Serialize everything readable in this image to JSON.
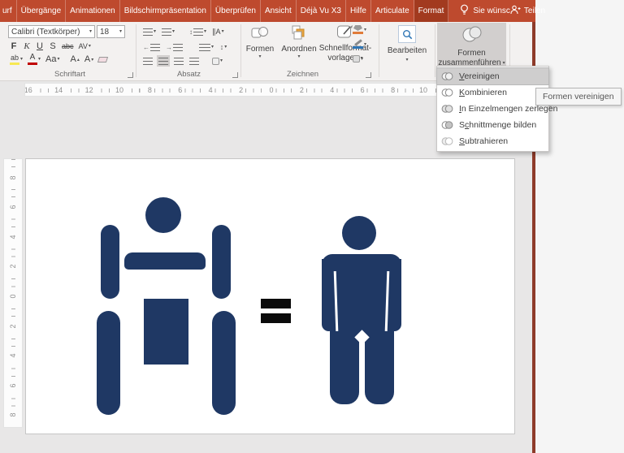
{
  "colors": {
    "tab_bar": "#BE4A2E",
    "tab_active": "#A23A1F",
    "window_border": "#8E3B2A",
    "ribbon_bg": "#F3F1F0",
    "pressed_gray": "#D2CFCE",
    "workspace_gray": "#E8E7E7",
    "shape_navy": "#1F3864",
    "equals_black": "#0B0B0B",
    "menu_highlight": "#CFCECE",
    "accent_orange": "#E8A33D",
    "accent_blue": "#2E75B5"
  },
  "tabbar": {
    "tabs": [
      {
        "label": "urf",
        "active": false
      },
      {
        "label": "Übergänge",
        "active": false
      },
      {
        "label": "Animationen",
        "active": false
      },
      {
        "label": "Bildschirmpräsentation",
        "active": false
      },
      {
        "label": "Überprüfen",
        "active": false
      },
      {
        "label": "Ansicht",
        "active": false
      },
      {
        "label": "Déjà Vu X3",
        "active": false
      },
      {
        "label": "Hilfe",
        "active": false
      },
      {
        "label": "Articulate",
        "active": false
      },
      {
        "label": "Format",
        "active": true
      }
    ],
    "tell_me": "Sie wünsc",
    "share": "Teilen"
  },
  "ribbon": {
    "font": {
      "title": "Schriftart",
      "name": "Calibri (Textkörper)",
      "size": "18",
      "bold": "F",
      "italic": "K",
      "underline": "U",
      "shadow": "S",
      "strike": "abc",
      "spacing": "AV",
      "highlight": "ab",
      "color": "A",
      "case": "Aa",
      "grow": "A",
      "shrink": "A"
    },
    "paragraph": {
      "title": "Absatz",
      "direction": "∥A",
      "valign": "↕",
      "outdent": "←",
      "indent": "→"
    },
    "drawing": {
      "title": "Zeichnen",
      "shapes": "Formen",
      "arrange": "Anordnen",
      "quick1": "Schnellformat-",
      "quick2": "vorlagen"
    },
    "editing": {
      "title": "Bearbeiten"
    },
    "merge": {
      "line1": "Formen",
      "line2": "zusammenführen"
    }
  },
  "merge_menu": {
    "items": [
      {
        "label": "Vereinigen",
        "underline_index": 0,
        "type": "union",
        "highlighted": true
      },
      {
        "label": "Kombinieren",
        "underline_index": 0,
        "type": "combine",
        "highlighted": false
      },
      {
        "label": "In Einzelmengen zerlegen",
        "underline_index": 0,
        "type": "fragment",
        "highlighted": false
      },
      {
        "label": "Schnittmenge bilden",
        "underline_index": 1,
        "type": "intersect",
        "highlighted": false
      },
      {
        "label": "Subtrahieren",
        "underline_index": 0,
        "type": "subtract",
        "highlighted": false
      }
    ]
  },
  "tooltip": "Formen vereinigen",
  "rulers": {
    "horizontal": [
      16,
      14,
      12,
      10,
      8,
      6,
      4,
      2,
      0,
      2,
      4,
      6,
      8,
      10
    ],
    "vertical": [
      8,
      6,
      4,
      2,
      0,
      2,
      4,
      6,
      8
    ]
  },
  "slide": {
    "equals_sign": "="
  }
}
